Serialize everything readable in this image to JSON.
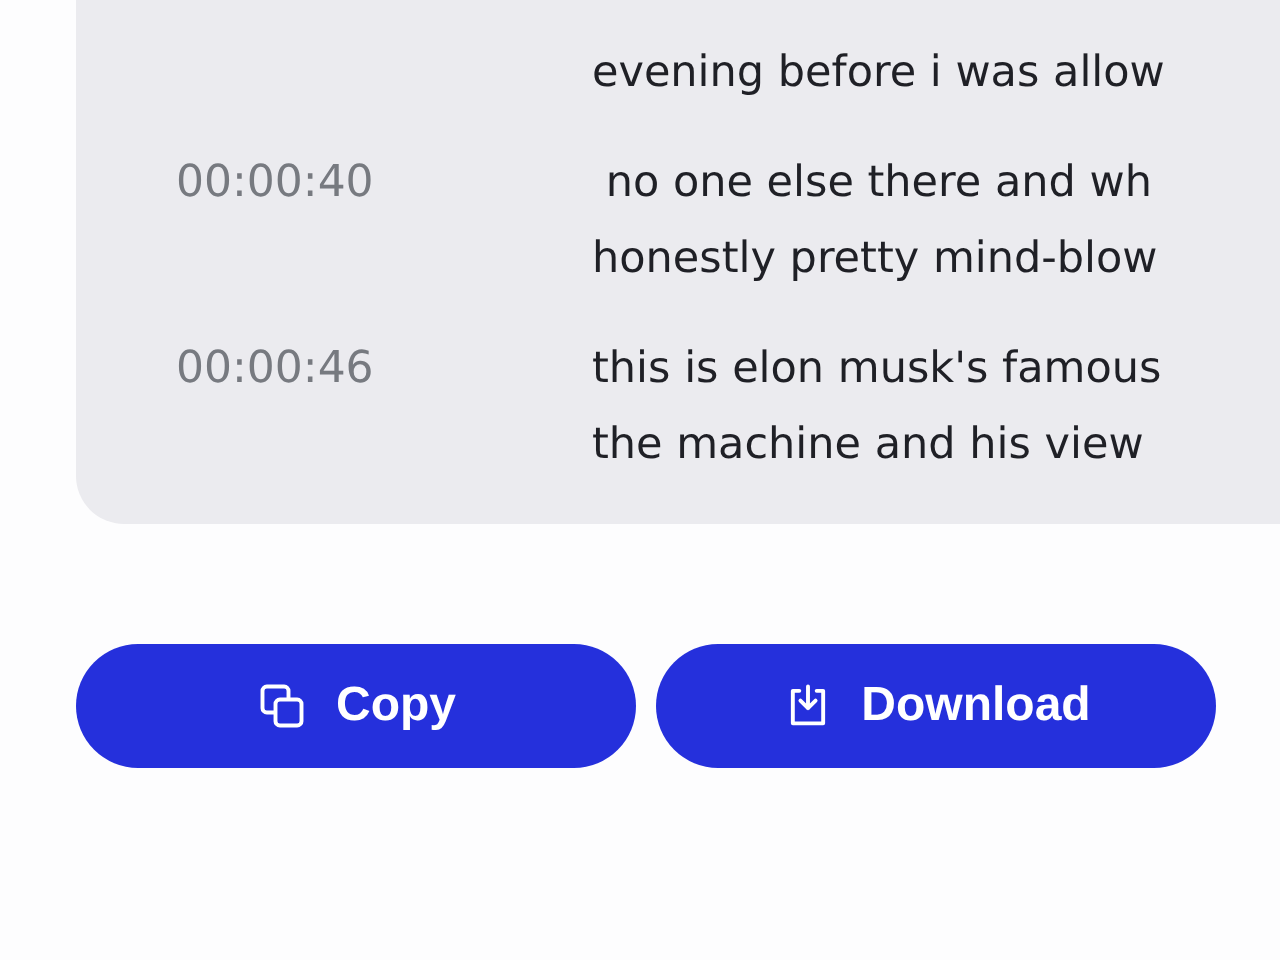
{
  "transcript": [
    {
      "lines": [
        "evening before i was allow"
      ]
    },
    {
      "time": "00:00:40",
      "lines": [
        " no one else there and wh",
        "honestly pretty mind-blow"
      ]
    },
    {
      "time": "00:00:46",
      "lines": [
        "this is elon musk's famous",
        "the machine and his view"
      ]
    }
  ],
  "buttons": [
    {
      "kind": "copy",
      "label": "Copy"
    },
    {
      "kind": "download",
      "label": "Download"
    }
  ]
}
